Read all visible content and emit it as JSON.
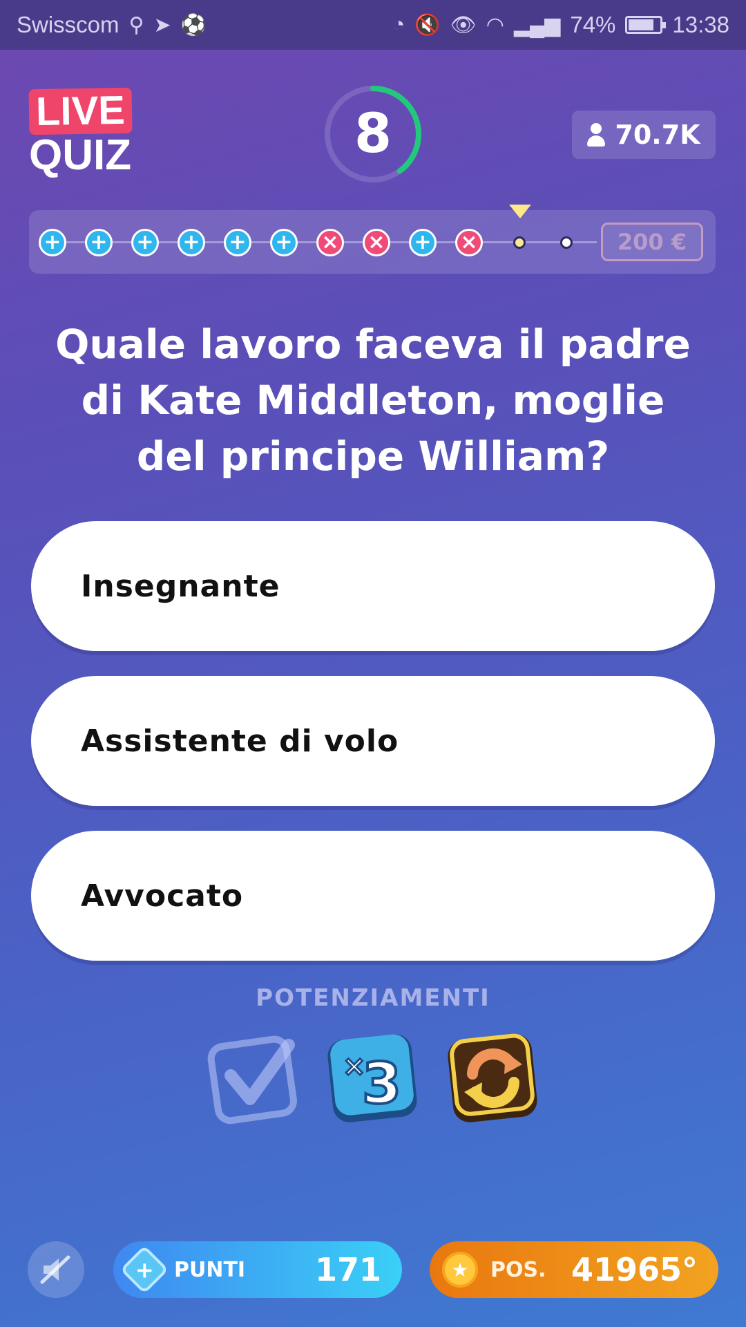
{
  "status_bar": {
    "carrier": "Swisscom",
    "battery": "74%",
    "time": "13:38"
  },
  "header": {
    "logo_live": "LIVE",
    "logo_quiz": "QUIZ",
    "timer": "8",
    "timer_fraction_remaining": 0.4,
    "viewers": "70.7K"
  },
  "progress": {
    "results": [
      "ok",
      "ok",
      "ok",
      "ok",
      "ok",
      "ok",
      "ko",
      "ko",
      "ok",
      "ko"
    ],
    "ok_symbol": "+",
    "ko_symbol": "×",
    "prize": "200 €"
  },
  "question": "Quale lavoro faceva il padre di Kate Middleton, moglie del principe William?",
  "answers": [
    "Insegnante",
    "Assistente di volo",
    "Avvocato"
  ],
  "powerups": {
    "title": "POTENZIAMENTI",
    "items": [
      {
        "icon": "checkmark-powerup-icon",
        "available": false
      },
      {
        "icon": "times-three-powerup-icon",
        "available": true
      },
      {
        "icon": "refresh-powerup-icon",
        "available": true
      }
    ]
  },
  "bottom": {
    "points_label": "PUNTI",
    "points_value": "171",
    "pos_label": "POS.",
    "pos_value": "41965°"
  },
  "colors": {
    "live_red": "#f0456b",
    "correct_blue": "#2fb6ee",
    "wrong_pink": "#ef4a78",
    "timer_green": "#22c97a",
    "points_blue": "#3f88f0",
    "pos_orange": "#e9780f"
  }
}
